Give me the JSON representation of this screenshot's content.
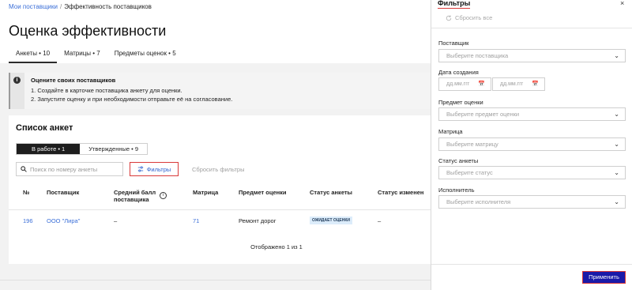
{
  "breadcrumb": {
    "root": "Мои поставщики",
    "separator": "/",
    "current": "Эффективность поставщиков"
  },
  "page": {
    "title": "Оценка эффективности"
  },
  "tabs": [
    {
      "label": "Анкеты • 10",
      "active": true
    },
    {
      "label": "Матрицы • 7",
      "active": false
    },
    {
      "label": "Предметы оценок • 5",
      "active": false
    }
  ],
  "info": {
    "icon": "info-icon",
    "title": "Оцените своих поставщиков",
    "line1": "1. Создайте в карточке поставщика анкету для оценки.",
    "line2": "2. Запустите оценку и при необходимости отправьте её на согласование."
  },
  "list": {
    "title": "Список анкет",
    "segments": [
      {
        "label": "В работе • 1",
        "active": true
      },
      {
        "label": "Утвержденные • 9",
        "active": false
      }
    ],
    "search_placeholder": "Поиск по номеру анкеты",
    "filters_button": "Фильтры",
    "reset_filters": "Сбросить фильтры",
    "columns": [
      "№",
      "Поставщик",
      "Средний балл поставщика",
      "Матрица",
      "Предмет оценки",
      "Статус анкеты",
      "Статус изменен"
    ],
    "rows": [
      {
        "num": "196",
        "supplier": "ООО \"Лира\"",
        "score": "–",
        "matrix": "71",
        "subject": "Ремонт дорог",
        "status": "ОЖИДАЕТ ОЦЕНКИ",
        "changed": "–"
      }
    ],
    "shown": "Отображено 1 из 1"
  },
  "filters": {
    "title": "Фильтры",
    "close": "×",
    "reset_all": "Сбросить все",
    "supplier_label": "Поставщик",
    "supplier_placeholder": "Выберите поставщика",
    "date_label": "Дата создания",
    "date_from_placeholder": "дд.мм.ггг",
    "date_to_placeholder": "дд.мм.ггг",
    "subject_label": "Предмет оценки",
    "subject_placeholder": "Выберите предмет оценки",
    "matrix_label": "Матрица",
    "matrix_placeholder": "Выберите матрицу",
    "status_label": "Статус анкеты",
    "status_placeholder": "Выберите статус",
    "executor_label": "Исполнитель",
    "executor_placeholder": "Выберите исполнителя",
    "apply": "Применить"
  },
  "colors": {
    "accent": "#1a1aa8",
    "link": "#3b6fd8",
    "highlight": "#d93a3a",
    "badge_bg": "#dcecfa"
  }
}
